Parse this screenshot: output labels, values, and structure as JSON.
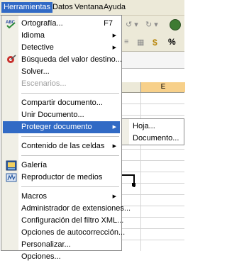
{
  "menubar": {
    "items": [
      {
        "label": "Herramientas",
        "active": true
      },
      {
        "label": "Datos"
      },
      {
        "label": "Ventana"
      },
      {
        "label": "Ayuda"
      }
    ]
  },
  "menu": {
    "items": [
      {
        "label": "Ortografía...",
        "shortcut": "F7",
        "icon": "spellcheck-icon"
      },
      {
        "label": "Idioma",
        "submenu": true
      },
      {
        "label": "Detective",
        "submenu": true
      },
      {
        "label": "Búsqueda del valor destino...",
        "icon": "goal-seek-icon"
      },
      {
        "label": "Solver..."
      },
      {
        "label": "Escenarios...",
        "disabled": true
      },
      {
        "label": "Compartir documento..."
      },
      {
        "label": "Unir Documento..."
      },
      {
        "label": "Proteger documento",
        "submenu": true,
        "highlighted": true
      },
      {
        "label": "Contenido de las celdas",
        "submenu": true
      },
      {
        "label": "Galería",
        "icon": "gallery-icon"
      },
      {
        "label": "Reproductor de medios",
        "icon": "media-player-icon"
      },
      {
        "label": "Macros",
        "submenu": true
      },
      {
        "label": "Administrador de extensiones..."
      },
      {
        "label": "Configuración del filtro XML..."
      },
      {
        "label": "Opciones de autocorrección..."
      },
      {
        "label": "Personalizar..."
      },
      {
        "label": "Opciones..."
      }
    ]
  },
  "submenu": {
    "items": [
      {
        "label": "Hoja..."
      },
      {
        "label": "Documento..."
      }
    ]
  },
  "sheet": {
    "column_label": "E",
    "toolbar_percent": "%"
  },
  "colors": {
    "highlight": "#316ac5",
    "menubar": "#ece9d8",
    "column_selected": "#f7d08a"
  }
}
